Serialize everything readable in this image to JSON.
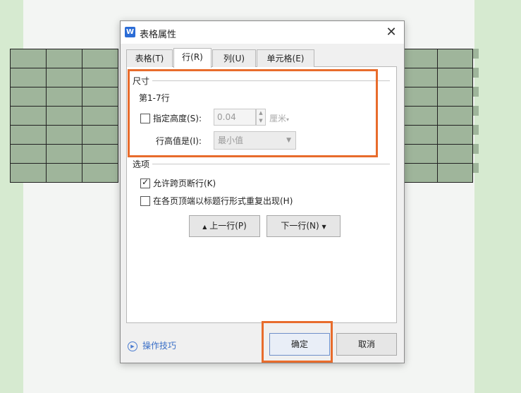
{
  "dialog": {
    "title": "表格属性",
    "app_icon": "W",
    "close_glyph": "✕",
    "tabs": [
      {
        "label": "表格(T)"
      },
      {
        "label": "行(R)"
      },
      {
        "label": "列(U)"
      },
      {
        "label": "单元格(E)"
      }
    ],
    "size_group": {
      "title": "尺寸",
      "rows_label": "第1-7行",
      "specify_height_label": "指定高度(S):",
      "specify_height_checked": false,
      "height_value": "0.04",
      "height_unit": "厘米",
      "row_height_is_label": "行高值是(I):",
      "row_height_is_value": "最小值"
    },
    "options_group": {
      "title": "选项",
      "allow_break_label": "允许跨页断行(K)",
      "allow_break_checked": true,
      "repeat_header_label": "在各页顶端以标题行形式重复出现(H)",
      "repeat_header_checked": false
    },
    "prev_row_label": "上一行(P)",
    "next_row_label": "下一行(N)",
    "help_label": "操作技巧",
    "ok_label": "确定",
    "cancel_label": "取消"
  },
  "colors": {
    "highlight": "#e86c2c",
    "table_cell": "#9fb59b",
    "background_green": "#d6ead0",
    "link_blue": "#3a6fc7"
  },
  "icons": {
    "app": "wps-writer-icon",
    "close": "close-icon",
    "help": "play-circle-icon",
    "spin": "spin-arrows-icon",
    "dropdown": "chevron-down-icon"
  }
}
